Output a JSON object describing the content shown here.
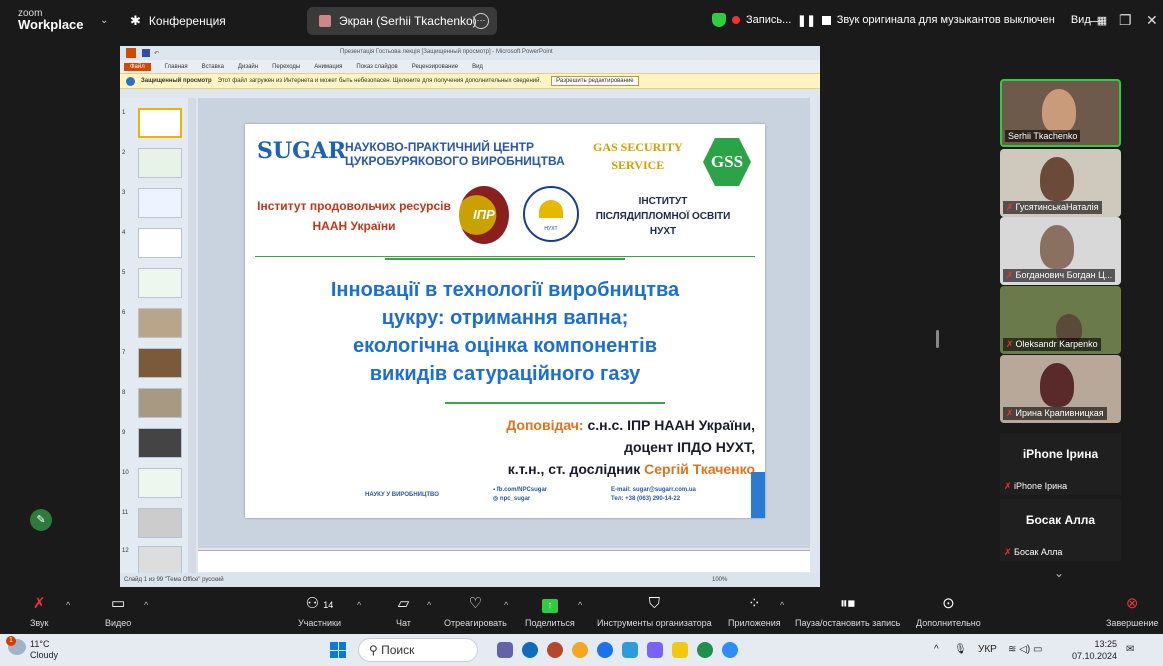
{
  "zoom": {
    "logo_line1": "zoom",
    "logo_line2": "Workplace",
    "meeting_label": "Конференция",
    "screen_share_label": "Экран (Serhii Tkachenko)",
    "recording_label": "Запись...",
    "original_sound": "Звук оригинала для музыкантов выключен",
    "view_label": "Вид"
  },
  "ppt": {
    "title": "Презентація Гостьова лекція [Защищенный просмотр] - Microsoft PowerPoint",
    "menu": [
      "Файл",
      "Главная",
      "Вставка",
      "Дизайн",
      "Переходы",
      "Анимация",
      "Показ слайдов",
      "Рецензирование",
      "Вид"
    ],
    "protected_title": "Защищенный просмотр",
    "protected_text": "Этот файл загружен из Интернета и может быть небезопасен. Щелкните для получения дополнительных сведений.",
    "protected_button": "Разрешить редактирование",
    "status": "Слайд 1 из 99   \"Тема Office\"   русский",
    "zoom": "100%",
    "thumb_numbers": [
      "1",
      "2",
      "3",
      "4",
      "5",
      "6",
      "7",
      "8",
      "9",
      "10",
      "11",
      "12"
    ]
  },
  "slide": {
    "org1_line1": "НАУКОВО-ПРАКТИЧНИЙ ЦЕНТР",
    "org1_line2": "ЦУКРОБУРЯКОВОГО ВИРОБНИЦТВА",
    "sugar_logo": "SUGAR",
    "gss_line1": "GAS SECURITY",
    "gss_line2": "SERVICE",
    "gss_badge": "GSS",
    "ipr_line1": "Інститут продовольчих ресурсів",
    "ipr_line2": "НААН України",
    "ipr_logo": "ІПР",
    "nuht_logo": "НУХТ",
    "ipdo_line1": "ІНСТИТУТ",
    "ipdo_line2": "ПІСЛЯДИПЛОМНОЇ ОСВІТИ",
    "ipdo_line3": "НУХТ",
    "title_line1": "Інновації в технології виробництва",
    "title_line2": "цукру: отримання вапна;",
    "title_line3": "екологічна оцінка компонентів",
    "title_line4": "викидів сатураційного газу",
    "speaker_label": "Доповідач:",
    "speaker_line1": "с.н.с. ІПР НААН України,",
    "speaker_line2": "доцент ІПДО НУХТ,",
    "speaker_line3": "к.т.н., ст. дослідник",
    "speaker_name": "Сергій Ткаченко",
    "footer_slogan": "НАУКУ У ВИРОБНИЦТВО",
    "footer_fb": "fb.com/NPCsugar",
    "footer_ig": "npc_sugar",
    "footer_email": "E-mail: sugar@sugarr.com.ua",
    "footer_tel": "Тел: +38 (063) 290-14-22"
  },
  "participants": [
    {
      "name": "Serhii Tkachenko"
    },
    {
      "name": "ГусятинськаНаталія"
    },
    {
      "name": "Богданович Богдан Ц..."
    },
    {
      "name": "Oleksandr Karpenko"
    },
    {
      "name": "Ирина Крапивницкая"
    }
  ],
  "name_tiles": [
    {
      "title": "iPhone Ірина",
      "sub": "iPhone Ірина"
    },
    {
      "title": "Босак Алла",
      "sub": "Босак Алла"
    }
  ],
  "toolbar": {
    "audio": "Звук",
    "video": "Видео",
    "participants": "Участники",
    "participants_count": "14",
    "chat": "Чат",
    "react": "Отреагировать",
    "share": "Поделиться",
    "host_tools": "Инструменты организатора",
    "apps": "Приложения",
    "pause_record": "Пауза/остановить запись",
    "more": "Дополнительно",
    "end": "Завершение"
  },
  "taskbar": {
    "temp": "11°C",
    "weather": "Cloudy",
    "weather_badge": "1",
    "search": "Поиск",
    "lang": "УКР",
    "time": "13:25",
    "date": "07.10.2024"
  }
}
